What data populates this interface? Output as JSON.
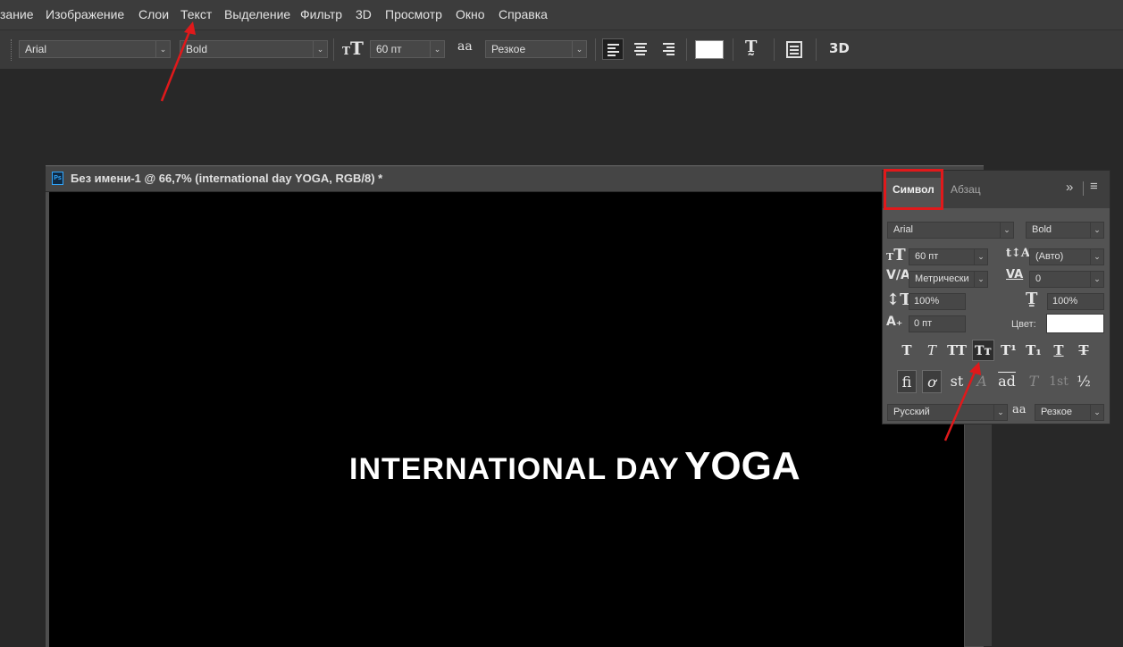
{
  "menubar": {
    "items": [
      "зание",
      "Изображение",
      "Слои",
      "Текст",
      "Выделение",
      "Фильтр",
      "3D",
      "Просмотр",
      "Окно",
      "Справка"
    ]
  },
  "options_bar": {
    "font_family": "Arial",
    "font_style": "Bold",
    "font_size": "60 пт",
    "antialias_icon": "aa",
    "antialias": "Резкое",
    "color_swatch": "#ffffff",
    "threed_label": "3D"
  },
  "document": {
    "ps_badge": "Ps",
    "title": "Без имени-1 @ 66,7% (international day YOGA, RGB/8) *",
    "canvas_text_small": "INTERNATIONAL DAY",
    "canvas_text_big": "YOGA",
    "canvas_bg": "#000000"
  },
  "character_panel": {
    "tabs": [
      "Символ",
      "Абзац"
    ],
    "font_family": "Arial",
    "font_style": "Bold",
    "size": "60 пт",
    "leading": "(Авто)",
    "kerning": "Метрически",
    "tracking": "0",
    "vertical_scale": "100%",
    "horizontal_scale": "100%",
    "baseline_shift": "0 пт",
    "color_label": "Цвет:",
    "color_value": "#ffffff",
    "format_buttons": [
      "T",
      "T",
      "TT",
      "Tт",
      "T¹",
      "T₁",
      "T",
      "T"
    ],
    "opentype_buttons": [
      "fi",
      "ơ",
      "st",
      "A",
      "ad",
      "T",
      "1st",
      "½"
    ],
    "language": "Русский",
    "antialias_icon": "aa",
    "antialias": "Резкое"
  },
  "annotations": {
    "highlight_color": "#e0191b"
  }
}
